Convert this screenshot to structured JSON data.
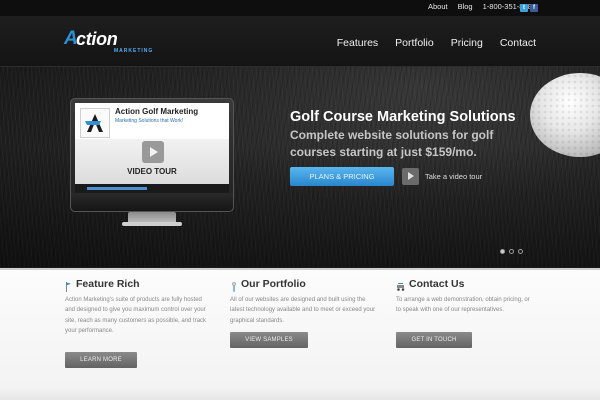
{
  "topbar": {
    "links": [
      "About",
      "Blog",
      "1-800-351-8280"
    ],
    "social": {
      "twitter": "t",
      "facebook": "f"
    }
  },
  "logo": {
    "mark": "A",
    "word": "ction",
    "subtitle": "MARKETING"
  },
  "nav": {
    "items": [
      "Features",
      "Portfolio",
      "Pricing",
      "Contact"
    ]
  },
  "hero": {
    "monitor": {
      "title": "Action Golf Marketing",
      "subtitle": "Marketing Solutions that Work!",
      "video_label": "VIDEO TOUR"
    },
    "title": "Golf Course Marketing Solutions",
    "subtitle": "Complete website solutions for golf courses starting at just $159/mo.",
    "cta_label": "PLANS & PRICING",
    "tour_label": "Take a video tour",
    "slides": {
      "count": 3,
      "active": 1
    }
  },
  "features": [
    {
      "title": "Feature Rich",
      "icon": "golf-flag-icon",
      "body": "Action Marketing's suite of products are fully hosted and designed to give you maximum control over your site, reach as many customers as possible, and track your performance.",
      "button": "LEARN MORE"
    },
    {
      "title": "Our Portfolio",
      "icon": "golf-tee-icon",
      "body": "All of our websites are designed and built using the latest technology available and to meet or exceed your graphical standards.",
      "button": "VIEW SAMPLES"
    },
    {
      "title": "Contact Us",
      "icon": "golf-cart-icon",
      "body": "To arrange a web demonstration, obtain pricing, or to speak with one of our representatives.",
      "button": "GET IN TOUCH"
    }
  ],
  "colors": {
    "accent": "#2f8fd6",
    "cta": "#3a9be0",
    "button_gray": "#6f6f6f",
    "header_bg": "#1a1a1a"
  }
}
